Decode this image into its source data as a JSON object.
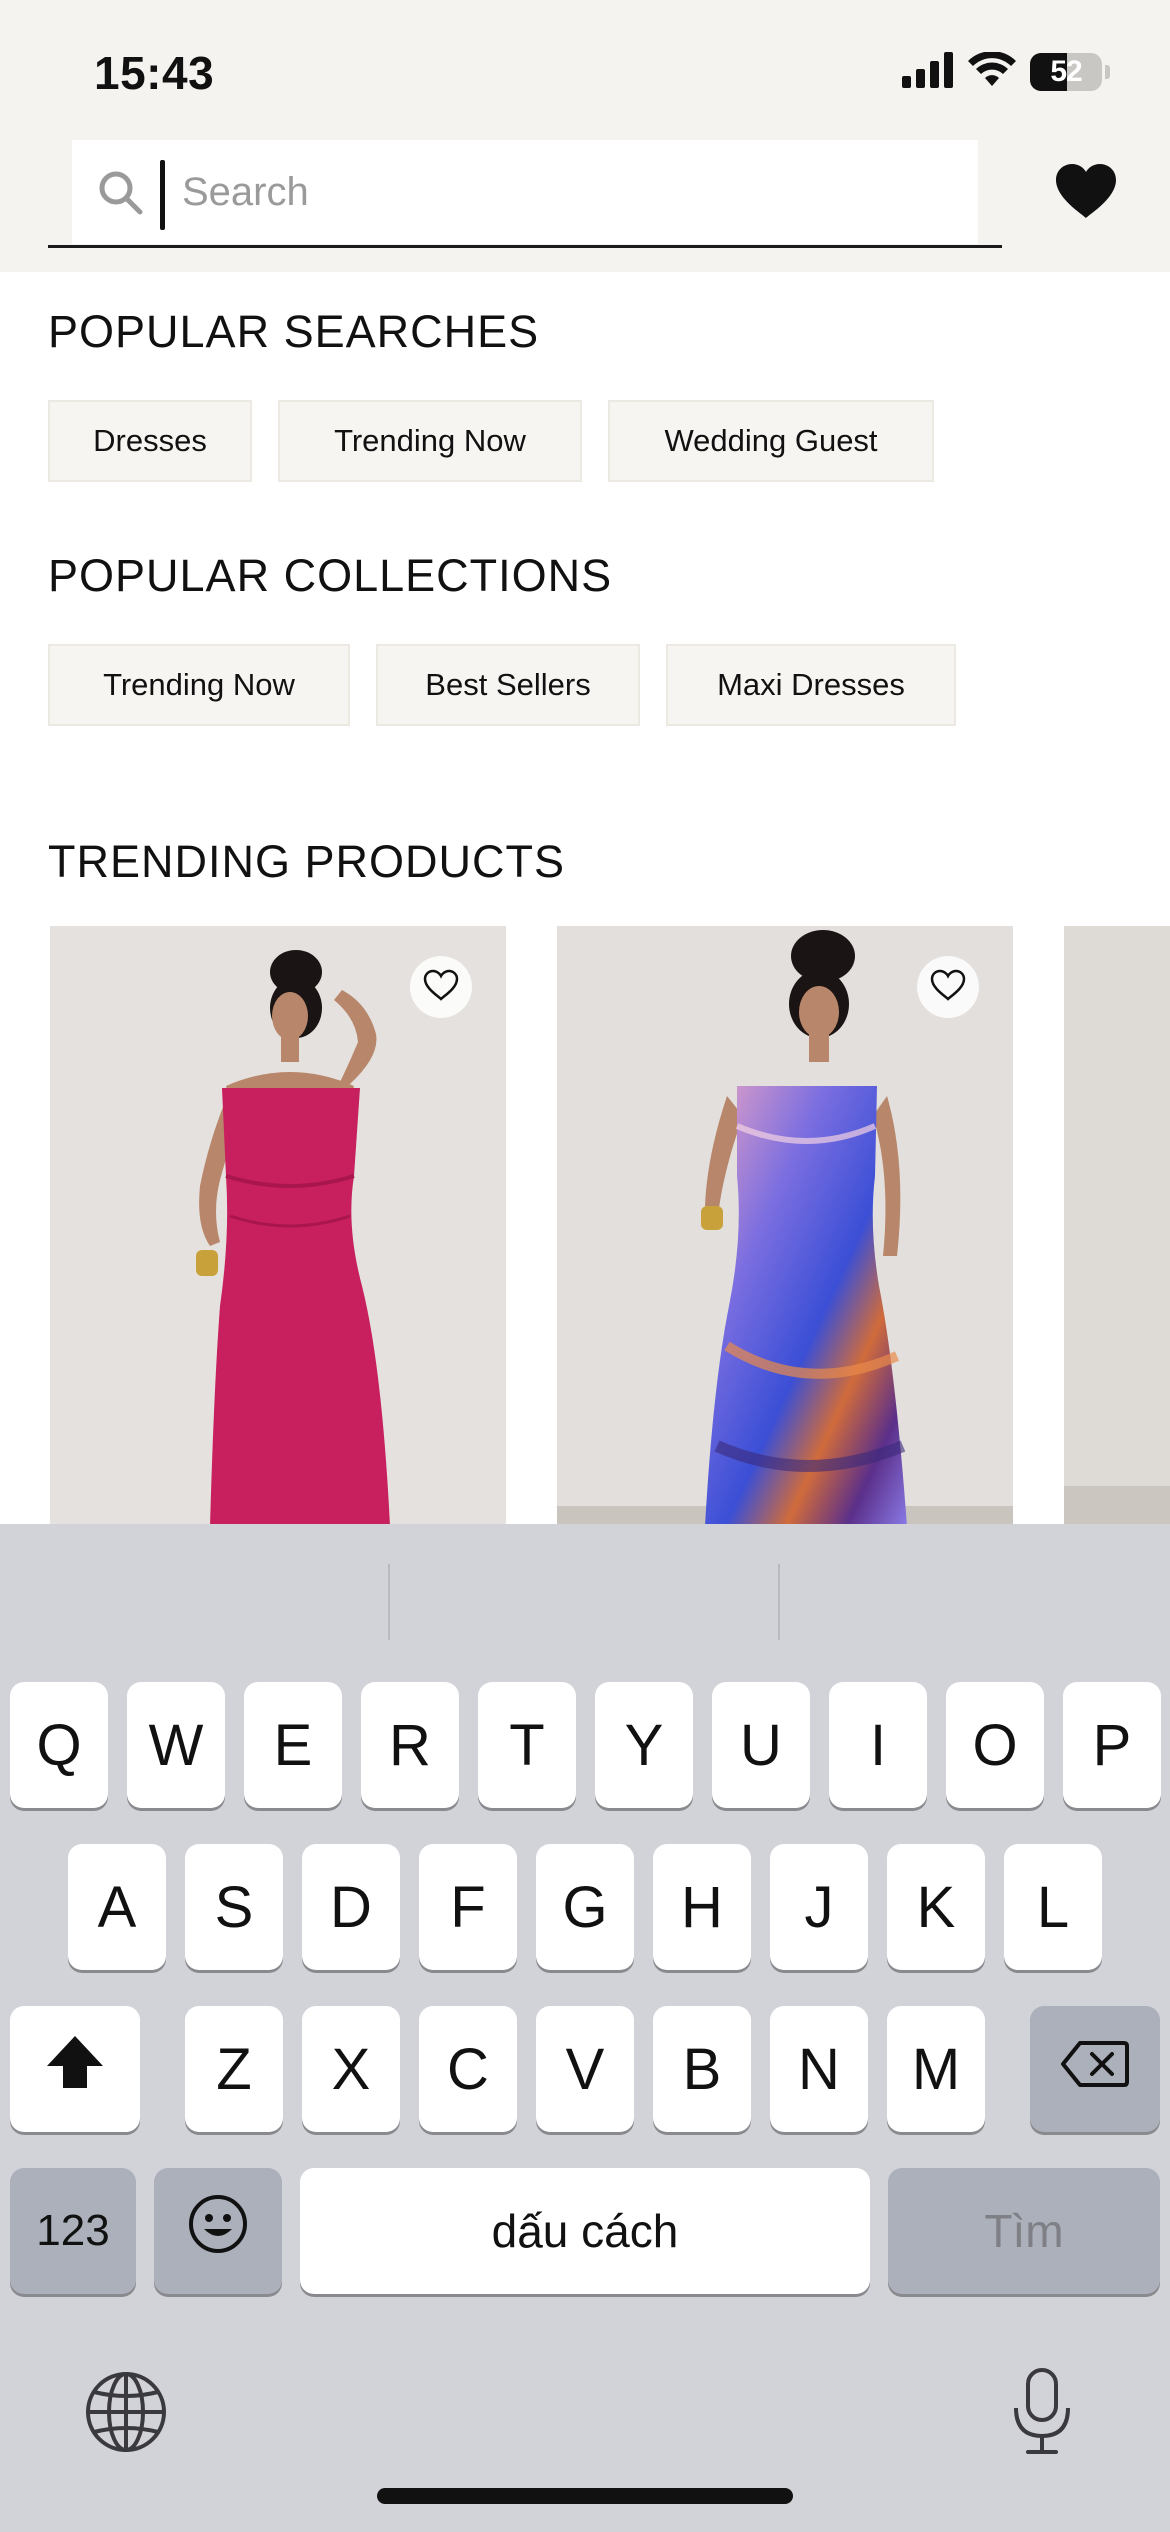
{
  "status_bar": {
    "time": "15:43",
    "battery": "52",
    "battery_level_percent": 52
  },
  "search": {
    "placeholder": "Search",
    "value": ""
  },
  "popular_searches": {
    "title": "POPULAR SEARCHES",
    "items": [
      "Dresses",
      "Trending Now",
      "Wedding Guest"
    ]
  },
  "popular_collections": {
    "title": "POPULAR COLLECTIONS",
    "items": [
      "Trending Now",
      "Best Sellers",
      "Maxi Dresses"
    ]
  },
  "trending_products": {
    "title": "TRENDING PRODUCTS",
    "products": [
      {
        "image": "model-pink-strapless-maxi-dress",
        "dress_color": "#c81f5e"
      },
      {
        "image": "model-multicolor-print-maxi-dress",
        "dress_color": "#6e63d6"
      },
      {
        "image": "partial-product-image",
        "dress_color": "#d9d6d2"
      }
    ]
  },
  "keyboard": {
    "row1": [
      "Q",
      "W",
      "E",
      "R",
      "T",
      "Y",
      "U",
      "I",
      "O",
      "P"
    ],
    "row2": [
      "A",
      "S",
      "D",
      "F",
      "G",
      "H",
      "J",
      "K",
      "L"
    ],
    "row3": [
      "Z",
      "X",
      "C",
      "V",
      "B",
      "N",
      "M"
    ],
    "numbers": "123",
    "space": "dấu cách",
    "return": "Tìm"
  },
  "colors": {
    "header_bg": "#f5f3ef",
    "chip_bg": "#f7f5f1",
    "keyboard_bg": "#d2d3d9"
  }
}
